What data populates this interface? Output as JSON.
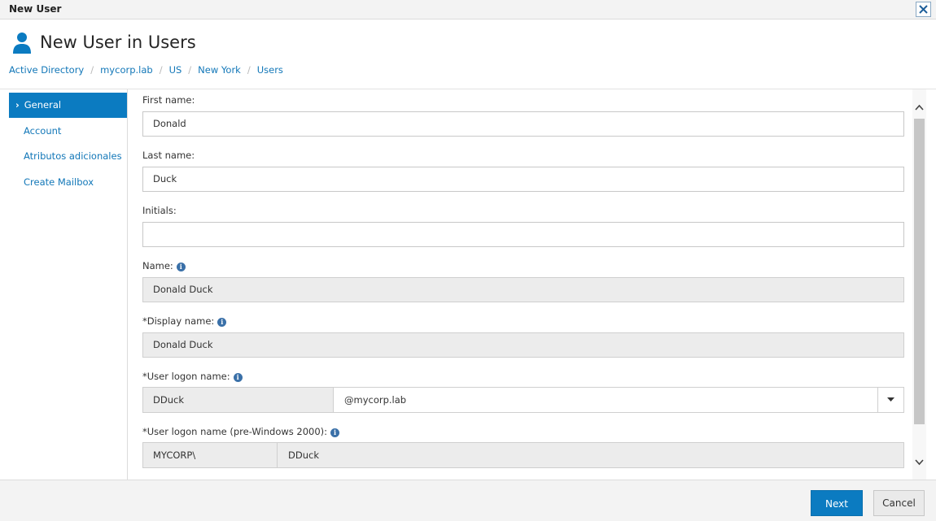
{
  "window": {
    "title": "New User"
  },
  "header": {
    "page_title": "New User in Users",
    "breadcrumb": [
      "Active Directory",
      "mycorp.lab",
      "US",
      "New York",
      "Users"
    ]
  },
  "sidebar": {
    "items": [
      {
        "label": "General",
        "active": true
      },
      {
        "label": "Account",
        "active": false
      },
      {
        "label": "Atributos adicionales",
        "active": false
      },
      {
        "label": "Create Mailbox",
        "active": false
      }
    ]
  },
  "form": {
    "first_name": {
      "label": "First name:",
      "value": "Donald"
    },
    "last_name": {
      "label": "Last name:",
      "value": "Duck"
    },
    "initials": {
      "label": "Initials:",
      "value": ""
    },
    "name": {
      "label": "Name:",
      "value": "Donald Duck"
    },
    "display_name": {
      "required_mark": "*",
      "label": "Display name:",
      "value": "Donald Duck"
    },
    "user_logon_name": {
      "required_mark": "*",
      "label": "User logon name:",
      "value": "DDuck",
      "domain": "@mycorp.lab"
    },
    "user_logon_pre2000": {
      "required_mark": "*",
      "label": "User logon name (pre-Windows 2000):",
      "prefix": "MYCORP\\",
      "value": "DDuck"
    }
  },
  "footer": {
    "next_label": "Next",
    "cancel_label": "Cancel"
  },
  "icons": {
    "close": "close-icon",
    "user": "user-icon",
    "info": "info-icon",
    "dropdown": "chevron-down-icon",
    "scroll_up": "chevron-up-icon",
    "scroll_down": "chevron-down-icon",
    "nav_active": "chevron-right-icon"
  },
  "colors": {
    "accent": "#0b7bc1",
    "link": "#1277b8",
    "readonly_bg": "#ececec"
  }
}
